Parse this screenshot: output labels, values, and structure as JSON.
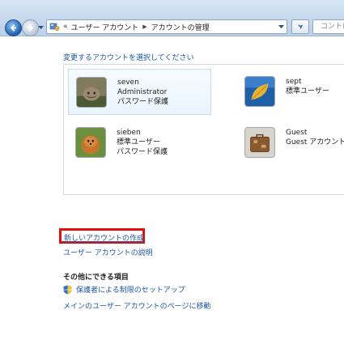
{
  "toolbar": {
    "breadcrumbs": [
      "ユーザー アカウント",
      "アカウントの管理"
    ],
    "search_placeholder": "コントロール パネルの検索"
  },
  "main": {
    "heading": "変更するアカウントを選択してください",
    "accounts": [
      {
        "name": "seven",
        "lines": [
          "Administrator",
          "パスワード保護"
        ],
        "avatar_icon": "cat-icon",
        "selected": true
      },
      {
        "name": "sept",
        "lines": [
          "標準ユーザー"
        ],
        "avatar_icon": "leaf-icon",
        "selected": false
      },
      {
        "name": "sieben",
        "lines": [
          "標準ユーザー",
          "パスワード保護"
        ],
        "avatar_icon": "dog-icon",
        "selected": false
      },
      {
        "name": "Guest",
        "lines": [
          "Guest アカウントは"
        ],
        "avatar_icon": "suitcase-icon",
        "selected": false
      }
    ],
    "create_account_link": "新しいアカウントの作成",
    "explain_link": "ユーザー アカウントの説明",
    "other_heading": "その他にできる項目",
    "parental_link": "保護者による制限のセットアップ",
    "main_page_link": "メインのユーザー アカウントのページに移動"
  },
  "colors": {
    "link": "#1f57a5",
    "highlight_box": "#e01010"
  }
}
